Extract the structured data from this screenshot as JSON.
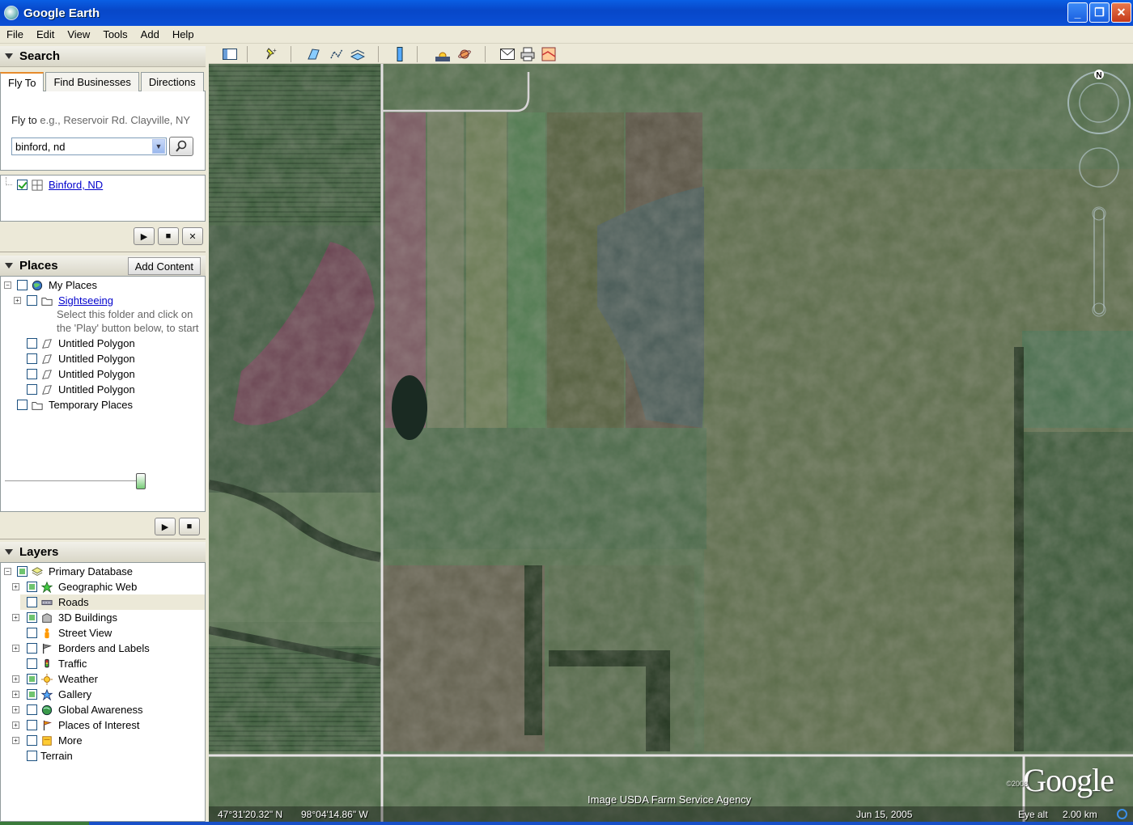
{
  "window": {
    "title": "Google Earth",
    "min": "_",
    "max": "❐",
    "close": "✕"
  },
  "menu": [
    "File",
    "Edit",
    "View",
    "Tools",
    "Add",
    "Help"
  ],
  "search": {
    "header": "Search",
    "tabs": [
      "Fly To",
      "Find Businesses",
      "Directions"
    ],
    "active_tab": "Fly To",
    "flyto_label": "Fly to",
    "flyto_hint": "e.g., Reservoir Rd. Clayville, NY",
    "input_value": "binford, nd",
    "result": "Binford, ND"
  },
  "places": {
    "header": "Places",
    "add_content": "Add Content",
    "items": [
      {
        "label": "My Places"
      },
      {
        "label": "Sightseeing"
      },
      {
        "label": "Untitled Polygon"
      },
      {
        "label": "Untitled Polygon"
      },
      {
        "label": "Untitled Polygon"
      },
      {
        "label": "Untitled Polygon"
      },
      {
        "label": "Temporary Places"
      }
    ],
    "note_line1": "Select this folder and click on",
    "note_line2": "the 'Play' button below, to start"
  },
  "layers": {
    "header": "Layers",
    "items": [
      {
        "label": "Primary Database"
      },
      {
        "label": "Geographic Web"
      },
      {
        "label": "Roads"
      },
      {
        "label": "3D Buildings"
      },
      {
        "label": "Street View"
      },
      {
        "label": "Borders and Labels"
      },
      {
        "label": "Traffic"
      },
      {
        "label": "Weather"
      },
      {
        "label": "Gallery"
      },
      {
        "label": "Global Awareness"
      },
      {
        "label": "Places of Interest"
      },
      {
        "label": "More"
      },
      {
        "label": "Terrain"
      }
    ]
  },
  "map": {
    "lat": "47°31'20.32\" N",
    "lon": "98°04'14.86\" W",
    "credit": "Image USDA Farm Service Agency",
    "date": "Jun 15, 2005",
    "eye_alt_label": "Eye alt",
    "eye_alt_value": "2.00 km",
    "logo": "Google",
    "copyright": "©2008",
    "north": "N"
  }
}
